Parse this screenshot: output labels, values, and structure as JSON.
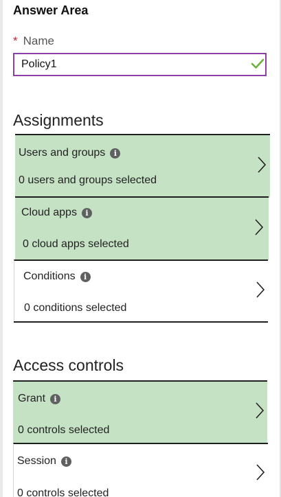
{
  "header": {
    "title": "Answer Area"
  },
  "name_field": {
    "required_marker": "*",
    "label": "Name",
    "value": "Policy1",
    "valid": true
  },
  "assignments": {
    "title": "Assignments",
    "items": [
      {
        "label": "Users and groups",
        "summary": "0 users and groups selected",
        "highlighted": true
      },
      {
        "label": "Cloud apps",
        "summary": "0 cloud apps selected",
        "highlighted": true
      },
      {
        "label": "Conditions",
        "summary": "0 conditions selected",
        "highlighted": false
      }
    ]
  },
  "access_controls": {
    "title": "Access controls",
    "items": [
      {
        "label": "Grant",
        "summary": "0 controls selected",
        "highlighted": true
      },
      {
        "label": "Session",
        "summary": "0 controls selected",
        "highlighted": false
      }
    ]
  },
  "icons": {
    "info": "info-icon",
    "chevron": "chevron-right-icon",
    "valid": "checkmark-icon"
  },
  "colors": {
    "highlight": "#c5e2c4",
    "focus_border": "#8d3fa6",
    "valid_check": "#6bb33d",
    "required": "#c4262e"
  }
}
